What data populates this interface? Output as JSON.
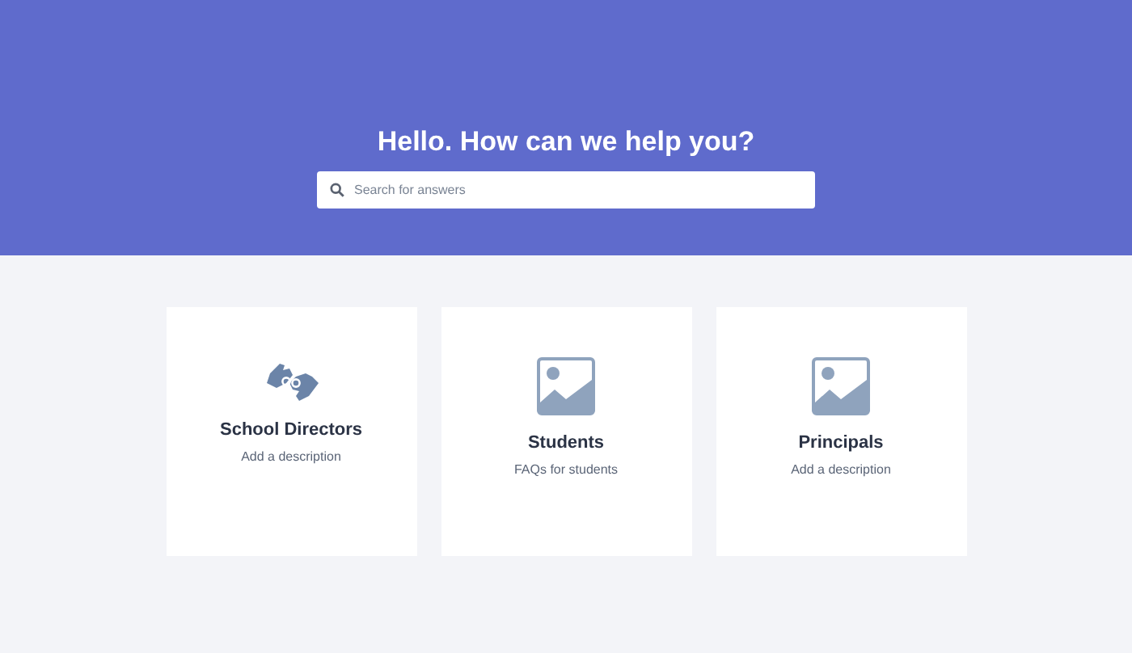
{
  "hero": {
    "title": "Hello. How can we help you?",
    "search": {
      "placeholder": "Search for answers"
    }
  },
  "categories": [
    {
      "kind": "hands",
      "title": "School Directors",
      "description": "Add a description"
    },
    {
      "kind": "image",
      "title": "Students",
      "description": "FAQs for students"
    },
    {
      "kind": "image",
      "title": "Principals",
      "description": "Add a description"
    }
  ]
}
